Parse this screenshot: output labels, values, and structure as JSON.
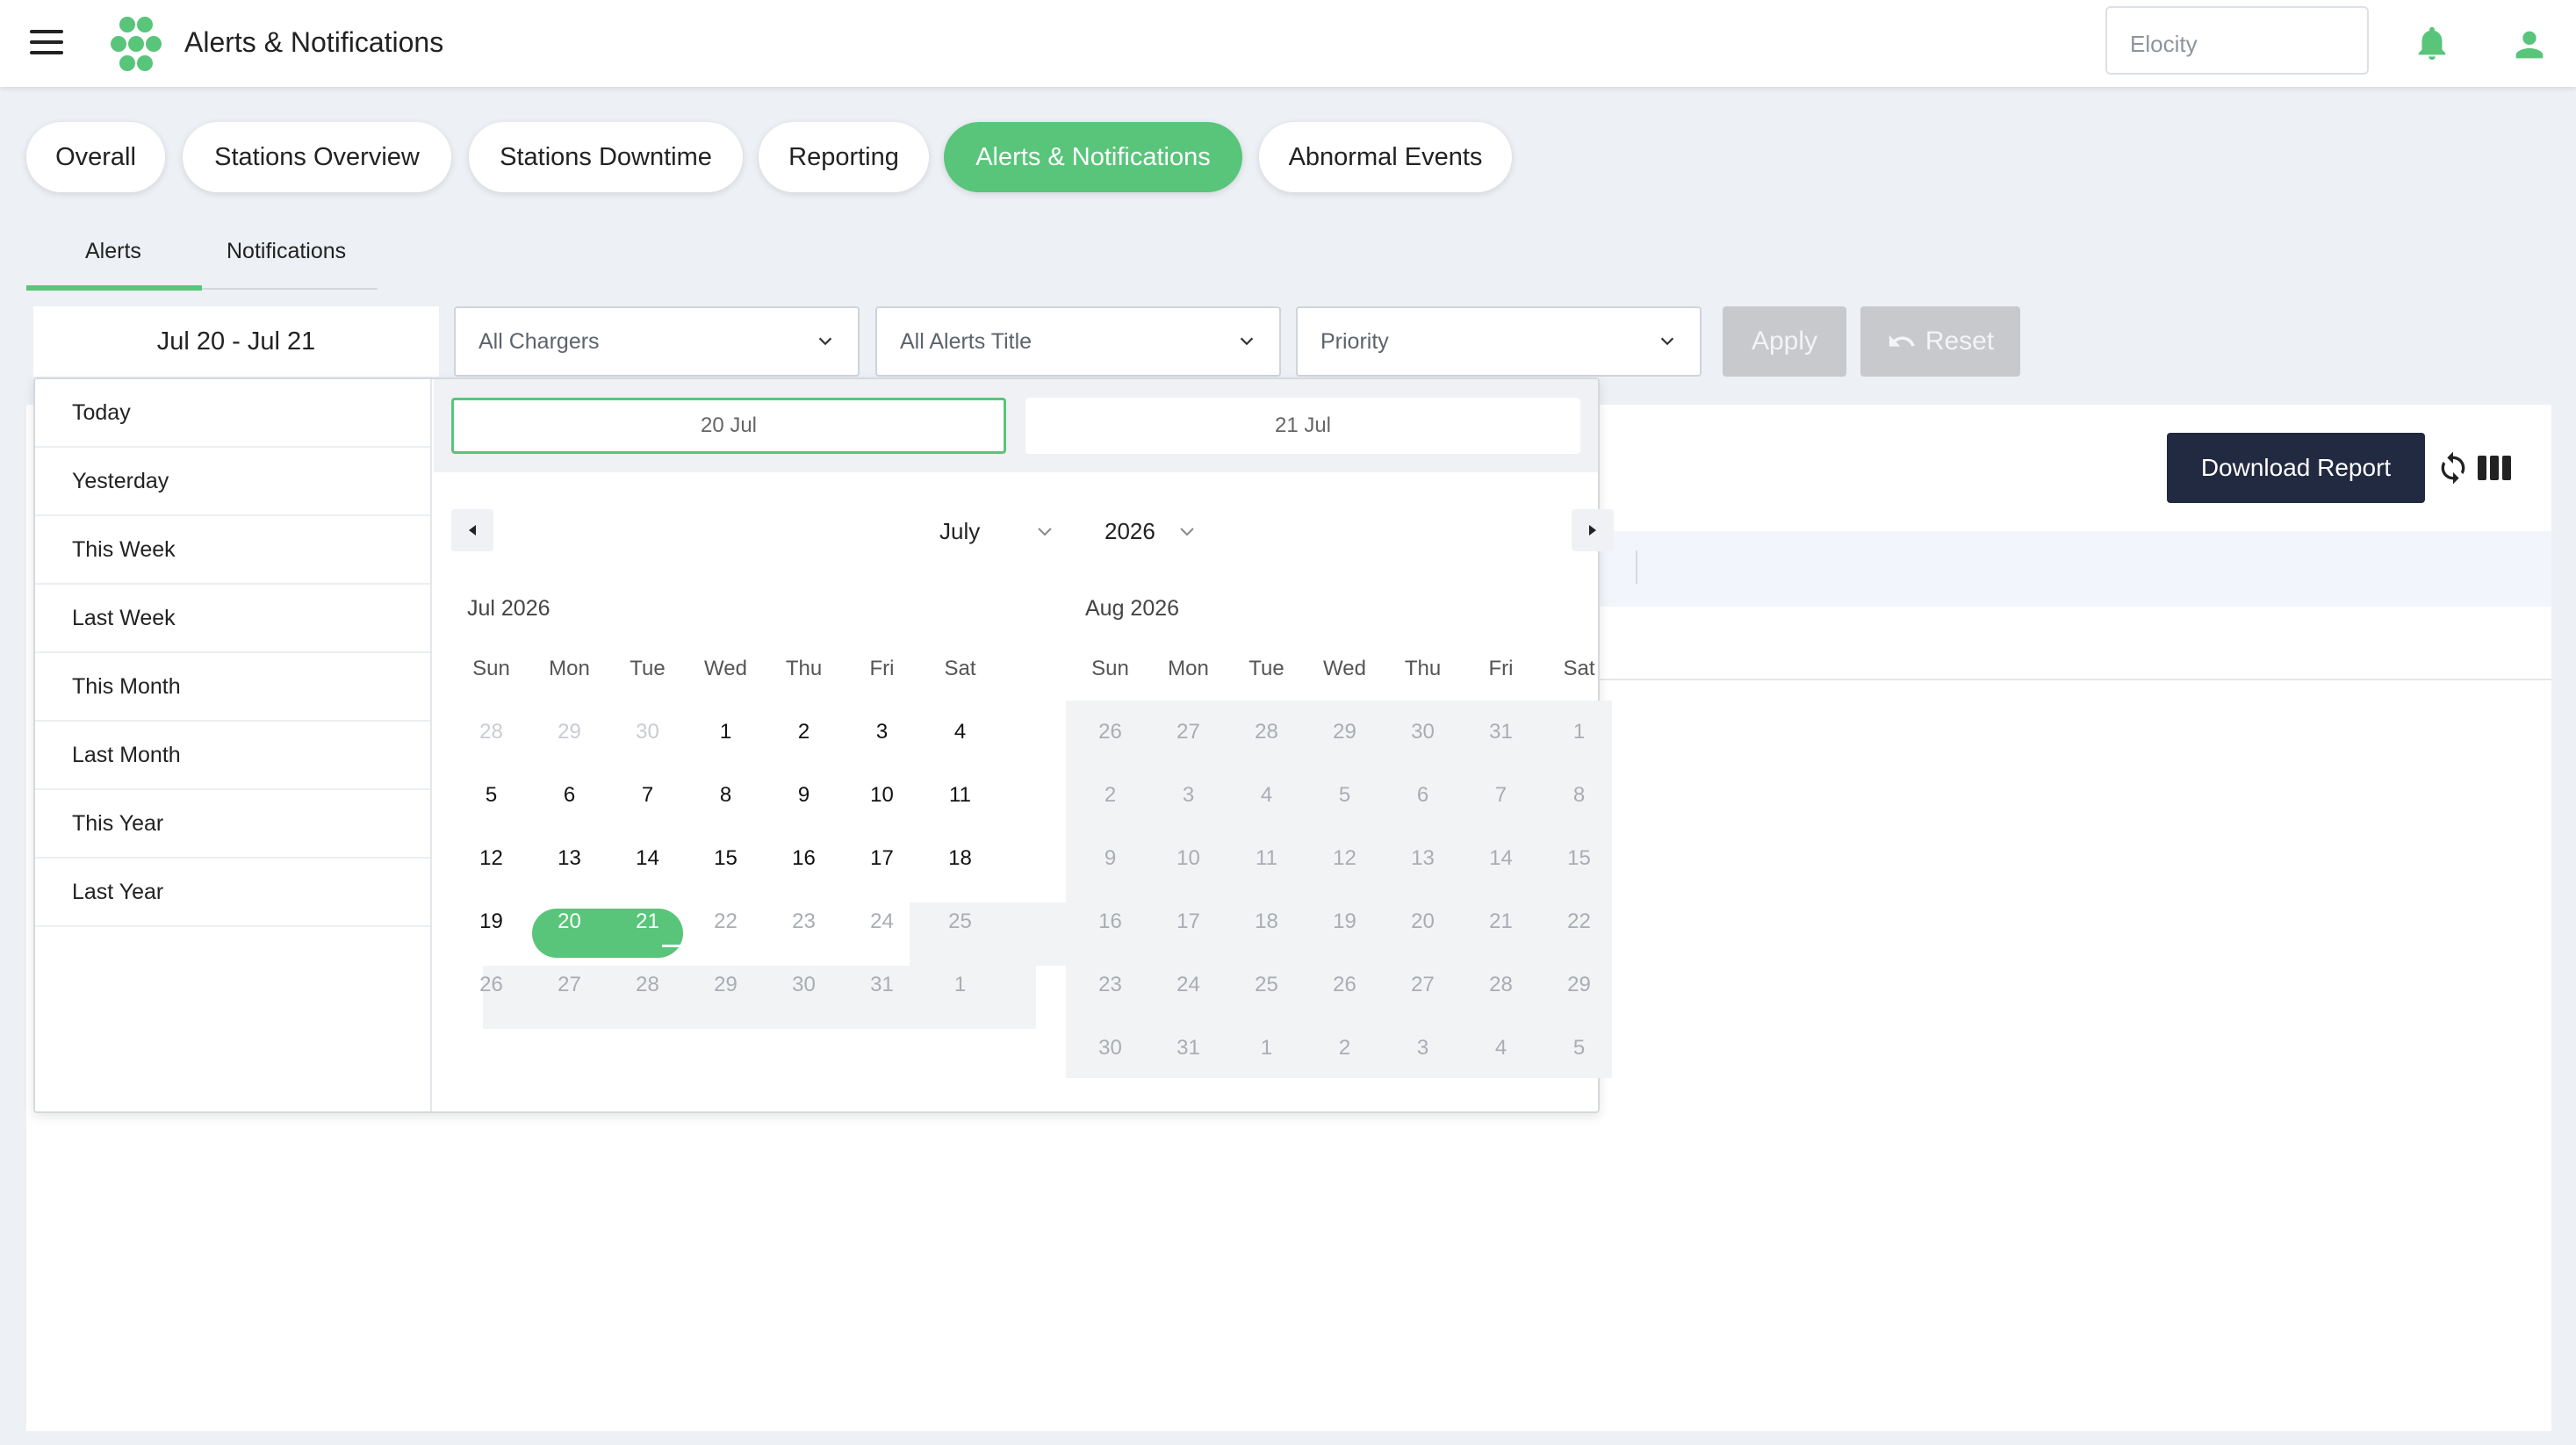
{
  "header": {
    "title": "Alerts & Notifications",
    "org_placeholder": "Elocity"
  },
  "main_tabs": [
    {
      "label": "Overall",
      "active": false
    },
    {
      "label": "Stations Overview",
      "active": false
    },
    {
      "label": "Stations Downtime",
      "active": false
    },
    {
      "label": "Reporting",
      "active": false
    },
    {
      "label": "Alerts & Notifications",
      "active": true
    },
    {
      "label": "Abnormal Events",
      "active": false
    }
  ],
  "sub_tabs": [
    {
      "label": "Alerts",
      "active": true
    },
    {
      "label": "Notifications",
      "active": false
    }
  ],
  "filters": {
    "date_range": "Jul 20 - Jul 21",
    "chargers": "All Chargers",
    "alerts_title": "All Alerts Title",
    "priority": "Priority",
    "apply": "Apply",
    "reset": "Reset"
  },
  "toolbar": {
    "download": "Download Report"
  },
  "date_picker": {
    "ranges": [
      "Today",
      "Yesterday",
      "This Week",
      "Last Week",
      "This Month",
      "Last Month",
      "This Year",
      "Last Year"
    ],
    "start_input": "20 Jul",
    "end_input": "21 Jul",
    "month_select": "July",
    "year_select": "2026",
    "weekdays": [
      "Sun",
      "Mon",
      "Tue",
      "Wed",
      "Thu",
      "Fri",
      "Sat"
    ],
    "months": [
      {
        "title": "Jul 2026",
        "weeks": [
          [
            "28",
            "29",
            "30",
            "1",
            "2",
            "3",
            "4"
          ],
          [
            "5",
            "6",
            "7",
            "8",
            "9",
            "10",
            "11"
          ],
          [
            "12",
            "13",
            "14",
            "15",
            "16",
            "17",
            "18"
          ],
          [
            "19",
            "20",
            "21",
            "22",
            "23",
            "24",
            "25"
          ],
          [
            "26",
            "27",
            "28",
            "29",
            "30",
            "31",
            "1"
          ]
        ]
      },
      {
        "title": "Aug 2026",
        "weeks": [
          [
            "26",
            "27",
            "28",
            "29",
            "30",
            "31",
            "1"
          ],
          [
            "2",
            "3",
            "4",
            "5",
            "6",
            "7",
            "8"
          ],
          [
            "9",
            "10",
            "11",
            "12",
            "13",
            "14",
            "15"
          ],
          [
            "16",
            "17",
            "18",
            "19",
            "20",
            "21",
            "22"
          ],
          [
            "23",
            "24",
            "25",
            "26",
            "27",
            "28",
            "29"
          ],
          [
            "30",
            "31",
            "1",
            "2",
            "3",
            "4",
            "5"
          ]
        ]
      }
    ],
    "selected": [
      "20",
      "21"
    ]
  },
  "colors": {
    "accent": "#58c57a",
    "dark_button": "#212a40",
    "disabled_button": "#c7c9cc"
  }
}
